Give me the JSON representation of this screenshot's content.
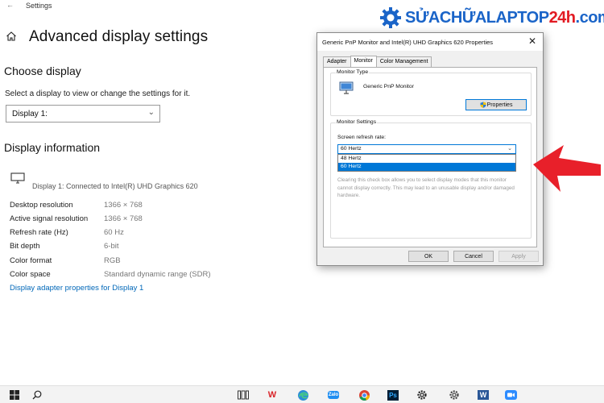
{
  "window": {
    "back_glyph": "←",
    "title": "Settings"
  },
  "page": {
    "title": "Advanced display settings"
  },
  "choose_display": {
    "heading": "Choose display",
    "hint": "Select a display to view or change the settings for it.",
    "selected": "Display 1:"
  },
  "display_info": {
    "heading": "Display information",
    "connected": "Display 1: Connected to Intel(R) UHD Graphics 620",
    "rows": [
      {
        "label": "Desktop resolution",
        "value": "1366 × 768"
      },
      {
        "label": "Active signal resolution",
        "value": "1366 × 768"
      },
      {
        "label": "Refresh rate (Hz)",
        "value": "60 Hz"
      },
      {
        "label": "Bit depth",
        "value": "6-bit"
      },
      {
        "label": "Color format",
        "value": "RGB"
      },
      {
        "label": "Color space",
        "value": "Standard dynamic range (SDR)"
      }
    ],
    "adapter_link": "Display adapter properties for Display 1"
  },
  "logo": {
    "part_blue": "SỬACHỮALAPTOP",
    "part_red": "24h",
    "part_tail": ".com",
    "brand_blue": "#1a64c8",
    "brand_red": "#e21b23"
  },
  "dialog": {
    "title": "Generic PnP Monitor and Intel(R) UHD Graphics 620 Properties",
    "close_glyph": "✕",
    "tabs": [
      "Adapter",
      "Monitor",
      "Color Management"
    ],
    "active_tab": "Monitor",
    "monitor_type": {
      "label": "Monitor Type",
      "name": "Generic PnP Monitor",
      "properties_button": "Properties"
    },
    "monitor_settings": {
      "label": "Monitor Settings",
      "refresh_label": "Screen refresh rate:",
      "selected_rate": "60 Hertz",
      "options": [
        "48 Hertz",
        "60 Hertz"
      ],
      "highlighted_option": "60 Hertz",
      "warning": "Clearing this check box allows you to select display modes that this monitor cannot display correctly. This may lead to an unusable display and/or damaged hardware."
    },
    "buttons": {
      "ok": "OK",
      "cancel": "Cancel",
      "apply": "Apply"
    }
  },
  "annotation": {
    "arrow_color": "#e8202a"
  },
  "taskbar": {
    "icons": [
      "windows-start-icon",
      "search-icon",
      "task-view-icon",
      "wps-icon",
      "edge-icon",
      "zalo-icon",
      "chrome-icon",
      "photoshop-icon",
      "settings-gear-icon",
      "word-icon",
      "zoom-icon"
    ],
    "wps_text": "W",
    "photoshop_text": "Ps",
    "word_text": "W",
    "zalo_text": "Zalo"
  }
}
